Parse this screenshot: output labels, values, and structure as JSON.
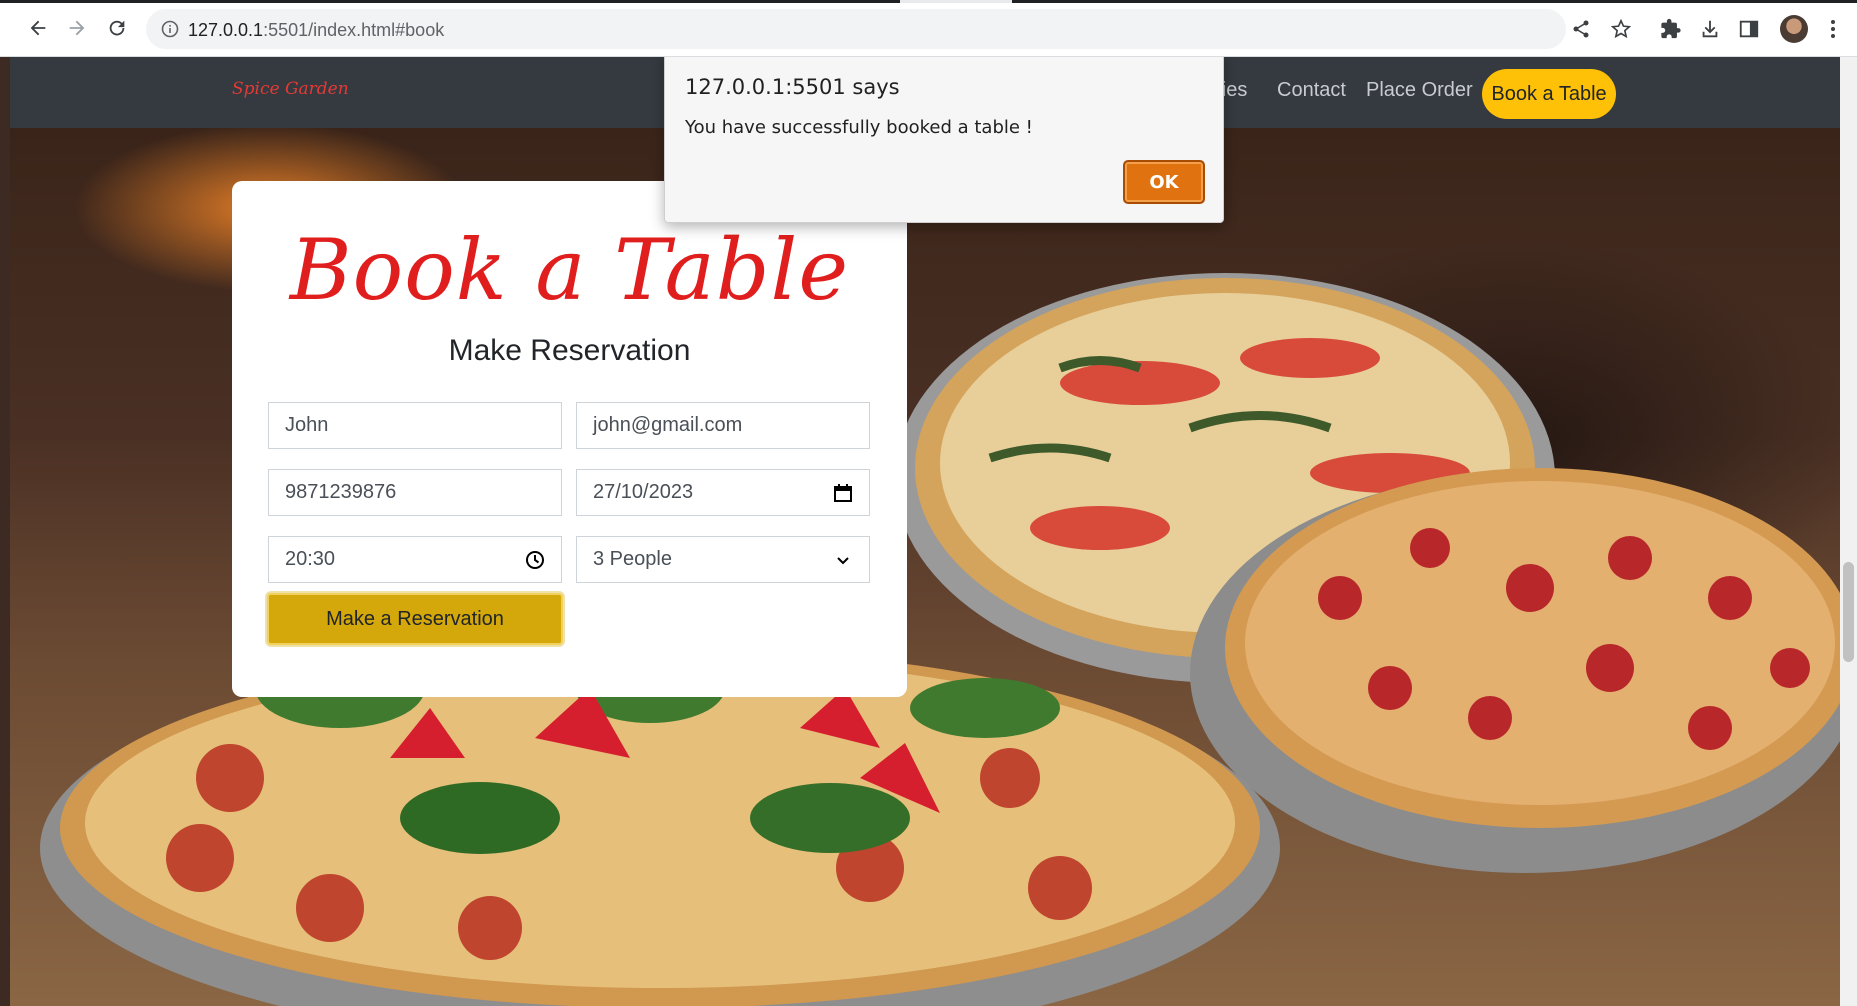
{
  "browser": {
    "url_host": "127.0.0.1",
    "url_rest": ":5501/index.html#book"
  },
  "navbar": {
    "brand": "Spice Garden",
    "links": [
      "ories",
      "Contact",
      "Place Order"
    ],
    "cta": "Book a Table"
  },
  "reservation": {
    "title": "Book a Table",
    "subtitle": "Make Reservation",
    "name": "John",
    "email": "john@gmail.com",
    "phone": "9871239876",
    "date": "27/10/2023",
    "time": "20:30",
    "people": "3 People",
    "submit_label": "Make a Reservation"
  },
  "alert": {
    "title": "127.0.0.1:5501 says",
    "message": "You have successfully booked a table !",
    "ok_label": "OK"
  },
  "colors": {
    "navbar_bg": "#343a40",
    "brand": "#e53935",
    "cta_bg": "#ffc107",
    "title_red": "#e01e1e",
    "submit_bg": "#d4a80a",
    "ok_bg": "#e0730f"
  }
}
